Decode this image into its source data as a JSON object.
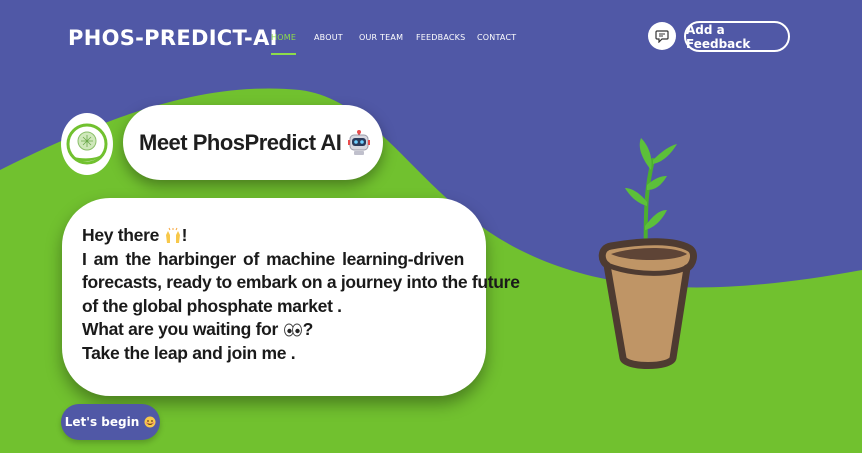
{
  "nav": {
    "brand": "PHOS-PREDICT-AI",
    "links": [
      "HOME",
      "ABOUT",
      "OUR TEAM",
      "FEEDBACKS",
      "CONTACT"
    ],
    "active_link": "HOME",
    "chat_icon": "chat-bubble-icon",
    "feedback_button": "Add a Feedback"
  },
  "hero": {
    "title": "Meet PhosPredict AI",
    "title_icon": "robot-icon",
    "greeting": "Hey there",
    "greeting_emoji": "raised-hands-icon",
    "greeting_suffix": "!",
    "line1": "I am the harbinger of machine learning-driven",
    "line2": "forecasts, ready to embark on a journey into the future",
    "line3": "of the global phosphate market .",
    "line4": "What are you waiting for",
    "line4_emoji": "eyes-icon",
    "line4_suffix": "?",
    "line5": "Take the leap and join me .",
    "begin_button": "Let's begin",
    "begin_icon": "smiling-face-icon"
  },
  "colors": {
    "background": "#5058a6",
    "green": "#71c12f",
    "accent": "#8ddc4a"
  }
}
